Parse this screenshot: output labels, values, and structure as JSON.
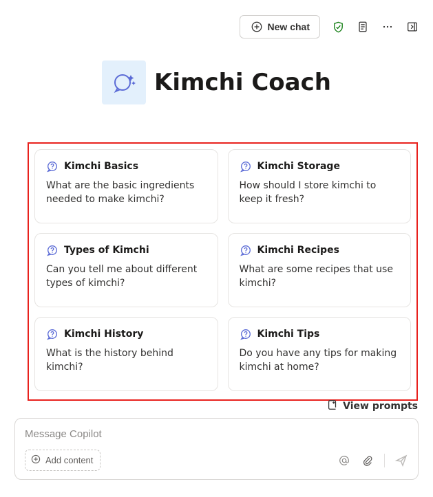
{
  "toolbar": {
    "new_chat_label": "New chat"
  },
  "hero": {
    "title": "Kimchi Coach"
  },
  "prompts": [
    {
      "title": "Kimchi Basics",
      "desc": "What are the basic ingredients needed to make kimchi?"
    },
    {
      "title": "Kimchi Storage",
      "desc": "How should I store kimchi to keep it fresh?"
    },
    {
      "title": "Types of Kimchi",
      "desc": "Can you tell me about different types of kimchi?"
    },
    {
      "title": "Kimchi Recipes",
      "desc": "What are some recipes that use kimchi?"
    },
    {
      "title": "Kimchi History",
      "desc": "What is the history behind kimchi?"
    },
    {
      "title": "Kimchi Tips",
      "desc": "Do you have any tips for making kimchi at home?"
    }
  ],
  "view_prompts_label": "View prompts",
  "compose": {
    "placeholder": "Message Copilot",
    "add_content_label": "Add content"
  }
}
